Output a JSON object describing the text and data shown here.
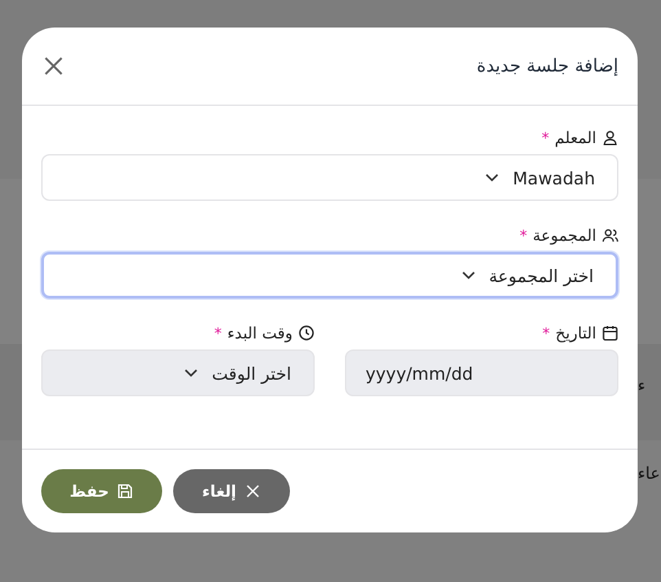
{
  "background": {
    "texts": [
      "ء",
      "عاء"
    ]
  },
  "dialog": {
    "title": "إضافة جلسة جديدة"
  },
  "fields": [
    {
      "kind": "teacher",
      "label": "المعلم",
      "required_mark": "*",
      "value": "Mawadah",
      "focused": false,
      "disabled": false
    },
    {
      "kind": "group",
      "label": "المجموعة",
      "required_mark": "*",
      "placeholder": "اختر المجموعة",
      "focused": true,
      "disabled": false
    }
  ],
  "row_fields": [
    {
      "kind": "date",
      "label": "التاريخ",
      "required_mark": "*",
      "placeholder": "yyyy/mm/dd",
      "focused": false,
      "disabled": true
    },
    {
      "kind": "time",
      "label": "وقت البدء",
      "required_mark": "*",
      "placeholder": "اختر الوقت",
      "focused": false,
      "disabled": true
    }
  ],
  "buttons": [
    {
      "kind": "cancel",
      "label": "إلغاء"
    },
    {
      "kind": "save",
      "label": "حفظ"
    }
  ]
}
